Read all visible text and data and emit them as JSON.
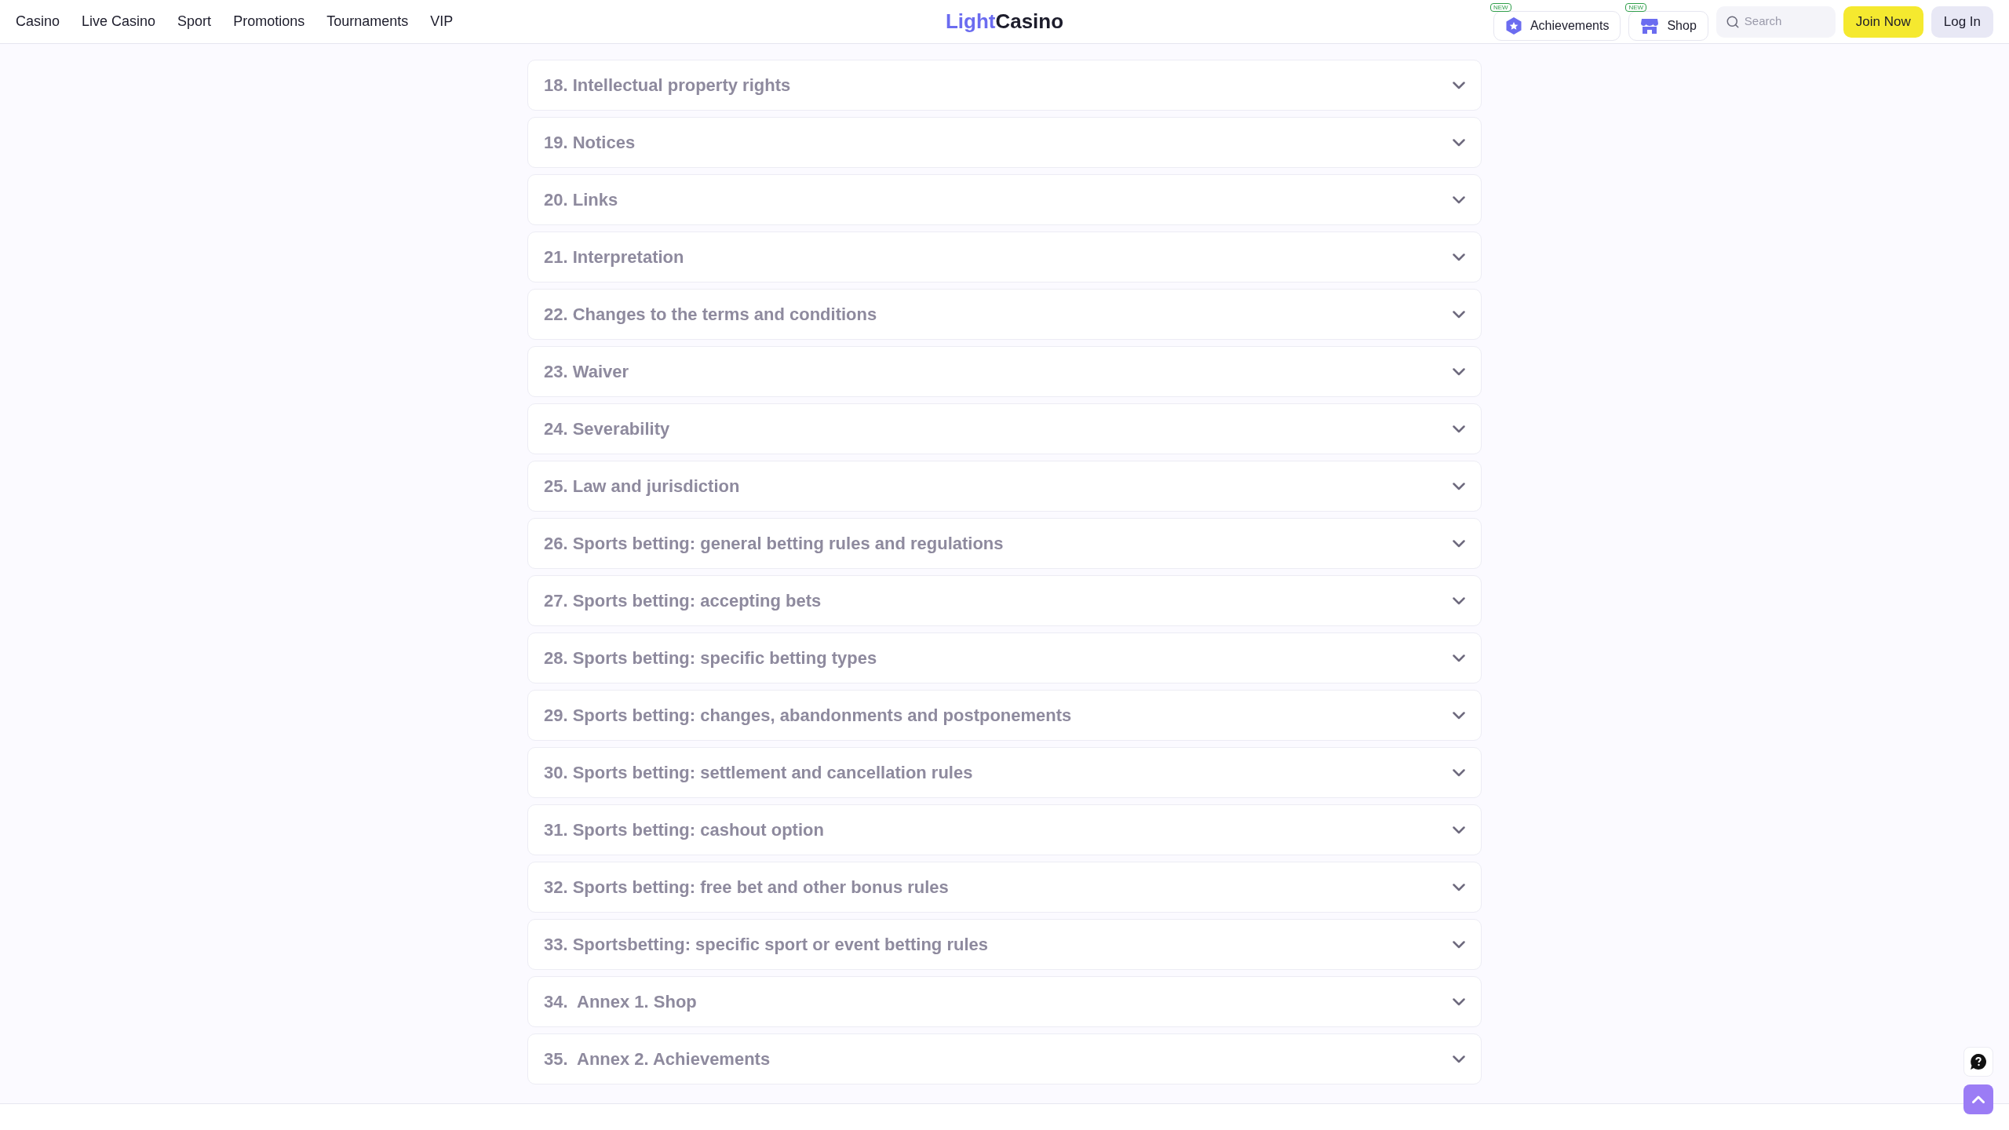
{
  "nav": [
    {
      "label": "Casino"
    },
    {
      "label": "Live Casino"
    },
    {
      "label": "Sport"
    },
    {
      "label": "Promotions"
    },
    {
      "label": "Tournaments"
    },
    {
      "label": "VIP"
    }
  ],
  "logo": {
    "accent": "Light",
    "rest": "Casino"
  },
  "header_links": [
    {
      "kind": "achievements",
      "label": "Achievements",
      "badge": "NEW"
    },
    {
      "kind": "shop",
      "label": "Shop",
      "badge": "NEW"
    }
  ],
  "search": {
    "placeholder": "Search"
  },
  "join_button": "Join Now",
  "login_button": "Log In",
  "sections": [
    {
      "title": "18. Intellectual property rights",
      "expanded": false
    },
    {
      "title": "19. Notices",
      "expanded": false
    },
    {
      "title": "20. Links",
      "expanded": false
    },
    {
      "title": "21. Interpretation",
      "expanded": false
    },
    {
      "title": "22. Changes to the terms and conditions",
      "expanded": false
    },
    {
      "title": "23. Waiver",
      "expanded": false
    },
    {
      "title": "24. Severability",
      "expanded": false
    },
    {
      "title": "25. Law and jurisdiction",
      "expanded": false
    },
    {
      "title": "26. Sports betting: general betting rules and regulations",
      "expanded": false
    },
    {
      "title": "27. Sports betting: accepting bets",
      "expanded": false
    },
    {
      "title": "28. Sports betting: specific betting types",
      "expanded": false
    },
    {
      "title": "29. Sports betting: changes, abandonments and postponements",
      "expanded": false
    },
    {
      "title": "30. Sports betting: settlement and cancellation rules",
      "expanded": false
    },
    {
      "title": "31. Sports betting: cashout option",
      "expanded": false
    },
    {
      "title": "32. Sports betting: free bet and other bonus rules",
      "expanded": false
    },
    {
      "title": "33. Sportsbetting: specific sport or event betting rules",
      "expanded": false
    },
    {
      "title": "34.  Annex 1. Shop",
      "expanded": false
    },
    {
      "title": "35.  Annex 2. Achievements",
      "expanded": false
    }
  ]
}
